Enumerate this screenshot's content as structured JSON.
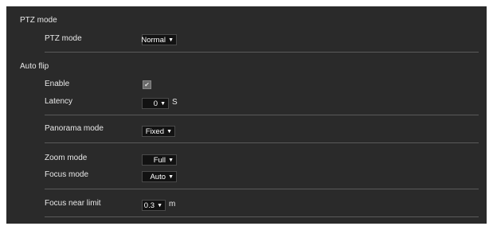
{
  "ptz_mode_section": {
    "heading": "PTZ mode",
    "ptz_mode_label": "PTZ mode",
    "ptz_mode_value": "Normal"
  },
  "auto_flip_section": {
    "heading": "Auto flip",
    "enable_label": "Enable",
    "enable_checked": true,
    "latency_label": "Latency",
    "latency_value": "0",
    "latency_unit": "S"
  },
  "panorama_section": {
    "panorama_label": "Panorama mode",
    "panorama_value": "Fixed"
  },
  "zoom_focus_section": {
    "zoom_label": "Zoom mode",
    "zoom_value": "Full",
    "focus_label": "Focus mode",
    "focus_value": "Auto"
  },
  "focus_limit_section": {
    "focus_near_label": "Focus near limit",
    "focus_near_value": "0.3",
    "focus_near_unit": "m"
  },
  "icons": {
    "dropdown": "chevron-down-icon",
    "check": "checkmark-icon"
  },
  "colors": {
    "panel_bg": "#2a2a2a",
    "select_bg": "#121212",
    "divider": "#5a5a5a",
    "text": "#e8e8e8"
  }
}
